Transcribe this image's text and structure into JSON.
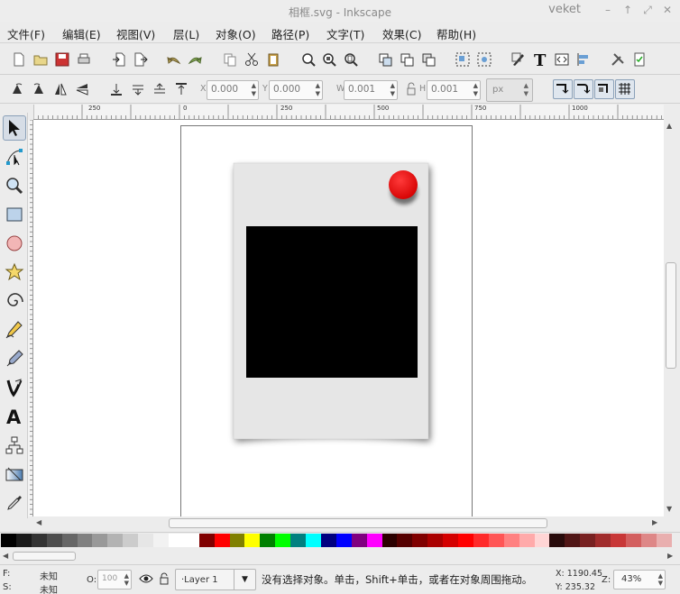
{
  "window": {
    "title": "相框.svg - Inkscape",
    "user": "veket"
  },
  "menu": [
    "文件(F)",
    "编辑(E)",
    "视图(V)",
    "层(L)",
    "对象(O)",
    "路径(P)",
    "文字(T)",
    "效果(C)",
    "帮助(H)"
  ],
  "toolbar2": {
    "x_label": "X",
    "x_value": "0.000",
    "y_label": "Y",
    "y_value": "0.000",
    "w_label": "W",
    "w_value": "0.001",
    "h_label": "H",
    "h_value": "0.001",
    "unit": "px"
  },
  "ruler": {
    "labels": [
      "250",
      "0",
      "250",
      "500",
      "750",
      "1000"
    ]
  },
  "status": {
    "fill_label": "F:",
    "fill_value": "未知",
    "stroke_label": "S:",
    "stroke_value": "未知",
    "opacity_label": "O:",
    "opacity_value": "100",
    "layer": "·Layer 1",
    "message": "没有选择对象。单击，Shift+单击，或者在对象周围拖动。",
    "x_coord": "X: 1190.45",
    "y_coord": "Y: 235.32",
    "zoom_label": "Z:",
    "zoom_value": "43%"
  },
  "palette_colors": [
    "#000000",
    "#1a1a1a",
    "#333333",
    "#4d4d4d",
    "#666666",
    "#808080",
    "#999999",
    "#b3b3b3",
    "#cccccc",
    "#e6e6e6",
    "#f2f2f2",
    "#ffffff",
    "#ffffff",
    "#800000",
    "#ff0000",
    "#808000",
    "#ffff00",
    "#008000",
    "#00ff00",
    "#008080",
    "#00ffff",
    "#000080",
    "#0000ff",
    "#800080",
    "#ff00ff",
    "#2b0000",
    "#550000",
    "#800000",
    "#aa0000",
    "#d40000",
    "#ff0000",
    "#ff2a2a",
    "#ff5555",
    "#ff8080",
    "#ffaaaa",
    "#ffd5d5",
    "#280b0b",
    "#501616",
    "#782121",
    "#a02c2c",
    "#c83737",
    "#d35f5f",
    "#de8787",
    "#e9afaf"
  ]
}
